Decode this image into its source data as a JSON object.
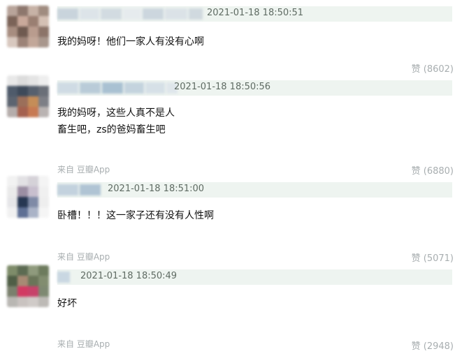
{
  "comments": [
    {
      "timestamp": "2021-01-18 18:50:51",
      "text_lines": [
        "我的妈呀！他们一家人有没有心啊"
      ],
      "source": "",
      "likes": "赞 (8602)"
    },
    {
      "timestamp": "2021-01-18 18:50:56",
      "text_lines": [
        "我的妈呀，这些人真不是人",
        "畜生吧，zs的爸妈畜生吧"
      ],
      "source": "来自 豆瓣App",
      "likes": "赞 (6880)"
    },
    {
      "timestamp": "2021-01-18 18:51:00",
      "text_lines": [
        "卧槽！！！这一家子还有没有人性啊"
      ],
      "source": "来自 豆瓣App",
      "likes": "赞 (5071)"
    },
    {
      "timestamp": "2021-01-18 18:50:49",
      "text_lines": [
        "好坏"
      ],
      "source": "来自 豆瓣App",
      "likes": "赞 (2948)"
    }
  ],
  "colors": {
    "header_bar": "#eef4f0",
    "meta_text": "#a8aeb0",
    "timestamp_text": "#5f6b63"
  }
}
